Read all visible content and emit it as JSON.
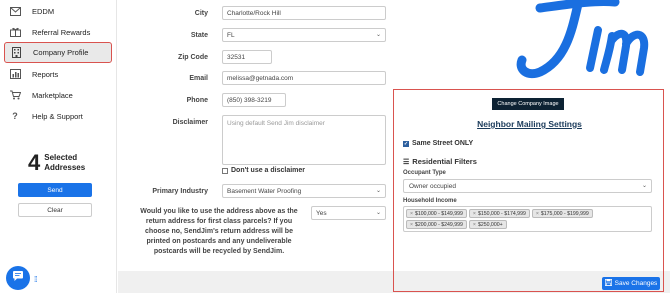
{
  "sidebar": {
    "items": [
      {
        "label": "EDDM",
        "icon": "envelope-icon"
      },
      {
        "label": "Referral Rewards",
        "icon": "gift-icon"
      },
      {
        "label": "Company Profile",
        "icon": "building-icon"
      },
      {
        "label": "Reports",
        "icon": "bar-chart-icon"
      },
      {
        "label": "Marketplace",
        "icon": "cart-icon"
      },
      {
        "label": "Help & Support",
        "icon": "question-icon"
      }
    ],
    "selected_count": "4",
    "selected_label_line1": "Selected",
    "selected_label_line2": "Addresses",
    "send_label": "Send",
    "clear_label": "Clear"
  },
  "form": {
    "city_label": "City",
    "city_value": "Charlotte/Rock Hill",
    "state_label": "State",
    "state_value": "FL",
    "zip_label": "Zip Code",
    "zip_value": "32531",
    "email_label": "Email",
    "email_value": "melissa@getnada.com",
    "phone_label": "Phone",
    "phone_value": "(850) 398-3219",
    "disclaimer_label": "Disclaimer",
    "disclaimer_placeholder": "Using default Send Jim disclaimer",
    "no_disclaimer_label": "Don't use a disclaimer",
    "industry_label": "Primary Industry",
    "industry_value": "Basement Water Proofing",
    "return_question": "Would you like to use the address above as the return address for first class parcels? If you choose no, SendJim's return address will be printed on postcards and any undeliverable postcards will be recycled by SendJim.",
    "return_value": "Yes"
  },
  "panel": {
    "change_image_label": "Change Company Image",
    "title": "Neighbor Mailing Settings",
    "same_street_label": "Same Street ONLY",
    "residential_filters_label": "Residential Filters",
    "occupant_type_label": "Occupant Type",
    "occupant_type_value": "Owner occupied",
    "household_income_label": "Household Income",
    "income_tags": [
      "$100,000 - $149,999",
      "$150,000 - $174,999",
      "$175,000 - $199,999",
      "$200,000 - $249,999",
      "$250,000+"
    ],
    "save_label": "Save Changes"
  },
  "colors": {
    "accent": "#1a73e8",
    "highlight_border": "#d9534f",
    "dark_button": "#0d2233"
  }
}
